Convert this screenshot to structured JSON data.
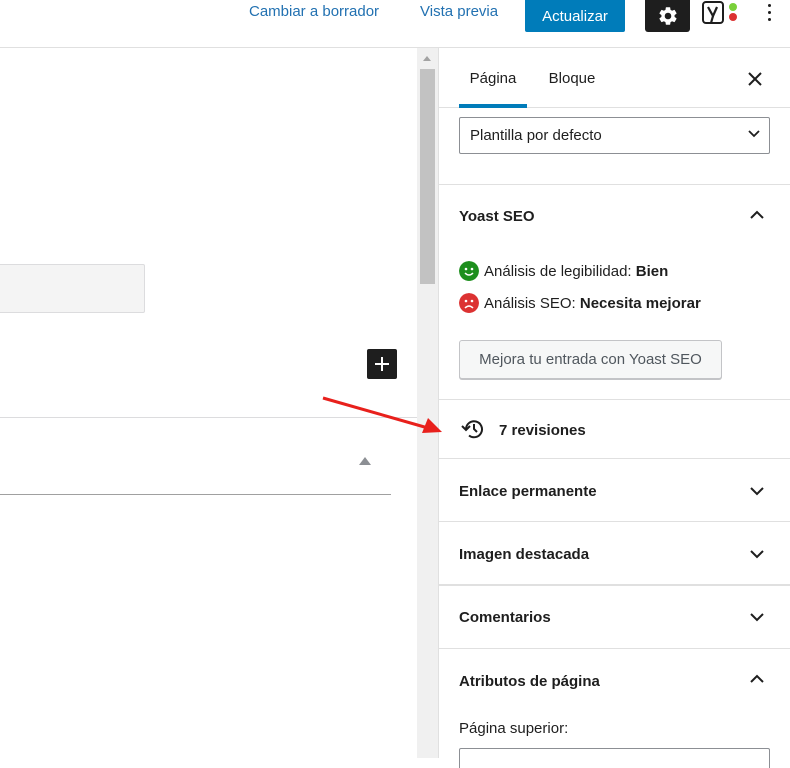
{
  "topbar": {
    "switch_draft": "Cambiar a borrador",
    "preview": "Vista previa",
    "update": "Actualizar"
  },
  "sidebar": {
    "tabs": [
      {
        "label": "Página",
        "active": true
      },
      {
        "label": "Bloque",
        "active": false
      }
    ],
    "template_select": "Plantilla por defecto",
    "yoast": {
      "title": "Yoast SEO",
      "readability_label": "Análisis de legibilidad:",
      "readability_value": "Bien",
      "seo_label": "Análisis SEO:",
      "seo_value": "Necesita mejorar",
      "button": "Mejora tu entrada con Yoast SEO"
    },
    "revisions": "7 revisiones",
    "panels": {
      "permalink": "Enlace permanente",
      "featured_image": "Imagen destacada",
      "comments": "Comentarios",
      "page_attributes": "Atributos de página"
    },
    "parent_page_label": "Página superior:"
  },
  "colors": {
    "accent": "#007cba",
    "link": "#2271b1",
    "good": "#1e8f1e",
    "bad": "#dc3232",
    "annotation_arrow": "#e8201c"
  }
}
